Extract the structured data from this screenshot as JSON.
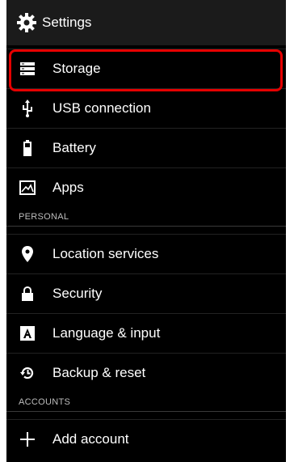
{
  "header": {
    "title": "Settings",
    "icon": "gear-icon"
  },
  "items": [
    {
      "label": "Storage",
      "icon": "storage-icon",
      "highlighted": true
    },
    {
      "label": "USB connection",
      "icon": "usb-icon"
    },
    {
      "label": "Battery",
      "icon": "battery-icon"
    },
    {
      "label": "Apps",
      "icon": "apps-icon"
    }
  ],
  "sections": {
    "personal": "PERSONAL",
    "accounts": "ACCOUNTS"
  },
  "personal_items": [
    {
      "label": "Location services",
      "icon": "location-icon"
    },
    {
      "label": "Security",
      "icon": "lock-icon"
    },
    {
      "label": "Language & input",
      "icon": "language-icon"
    },
    {
      "label": "Backup & reset",
      "icon": "backup-icon"
    }
  ],
  "account_items": [
    {
      "label": "Add account",
      "icon": "add-icon"
    }
  ],
  "colors": {
    "background": "#000000",
    "highlight": "#e60000",
    "text": "#ffffff"
  }
}
